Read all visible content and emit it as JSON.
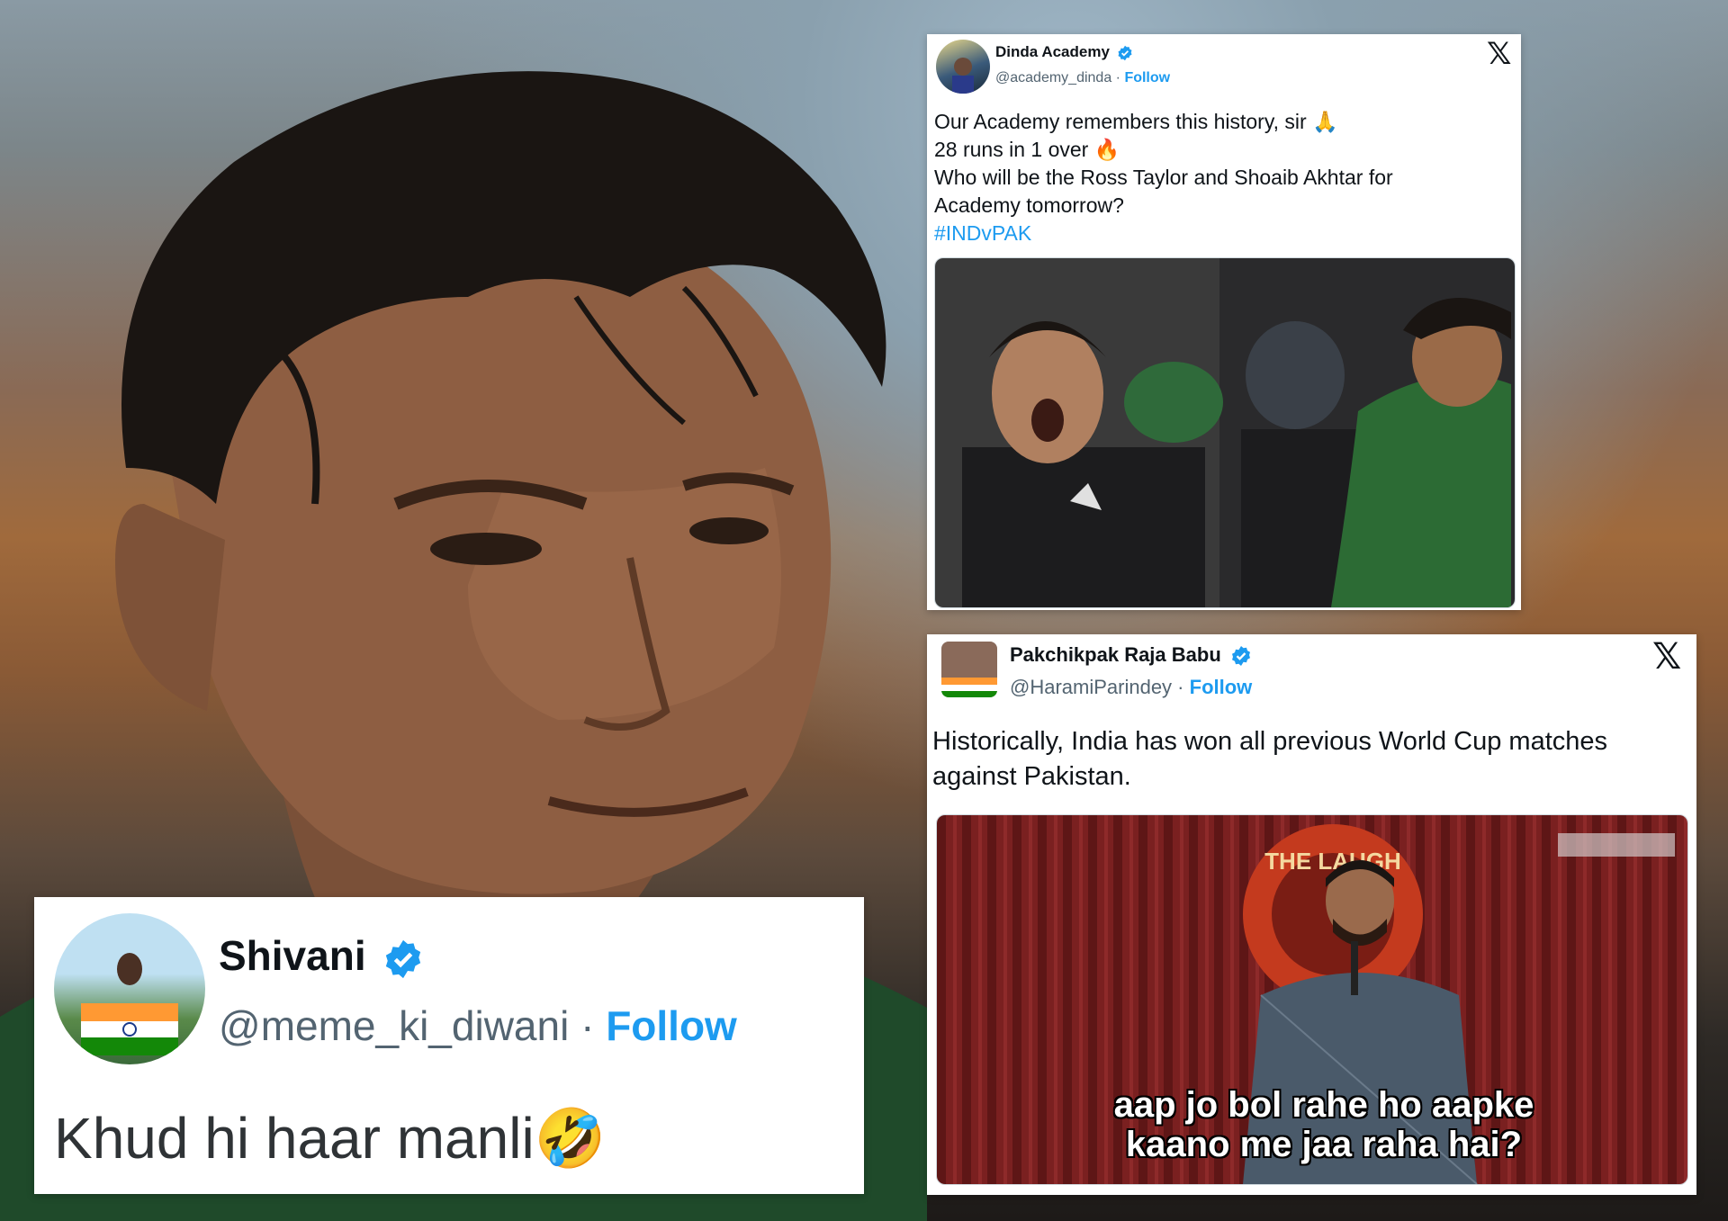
{
  "tweets": {
    "dinda": {
      "name": "Dinda Academy",
      "handle": "@academy_dinda",
      "separator": " · ",
      "follow": "Follow",
      "lines": [
        "Our Academy remembers this history, sir 🙏",
        "28 runs in 1 over 🔥",
        "Who will be the Ross Taylor and Shoaib Akhtar for",
        "Academy tomorrow?"
      ],
      "hashtag": "#INDvPAK",
      "x_icon": "close-icon"
    },
    "pakchikpak": {
      "name": "Pakchikpak Raja Babu",
      "handle": "@HaramiParindey",
      "separator": " · ",
      "follow": "Follow",
      "lines": [
        "Historically, India has won all previous World Cup matches",
        "against Pakistan."
      ],
      "media_caption": [
        "aap jo bol rahe ho aapke",
        "kaano me jaa raha hai?"
      ],
      "media_sign": "THE LAUGH",
      "x_icon": "close-icon"
    },
    "shivani": {
      "name": "Shivani",
      "handle": "@meme_ki_diwani",
      "separator": " · ",
      "follow": "Follow",
      "text": "Khud hi haar manli🤣"
    }
  },
  "colors": {
    "link": "#1d9bf0",
    "name": "#0f1419",
    "handle": "#536471",
    "pakistan_green": "#1f5a2a",
    "nz_black": "#1c1c1e"
  }
}
